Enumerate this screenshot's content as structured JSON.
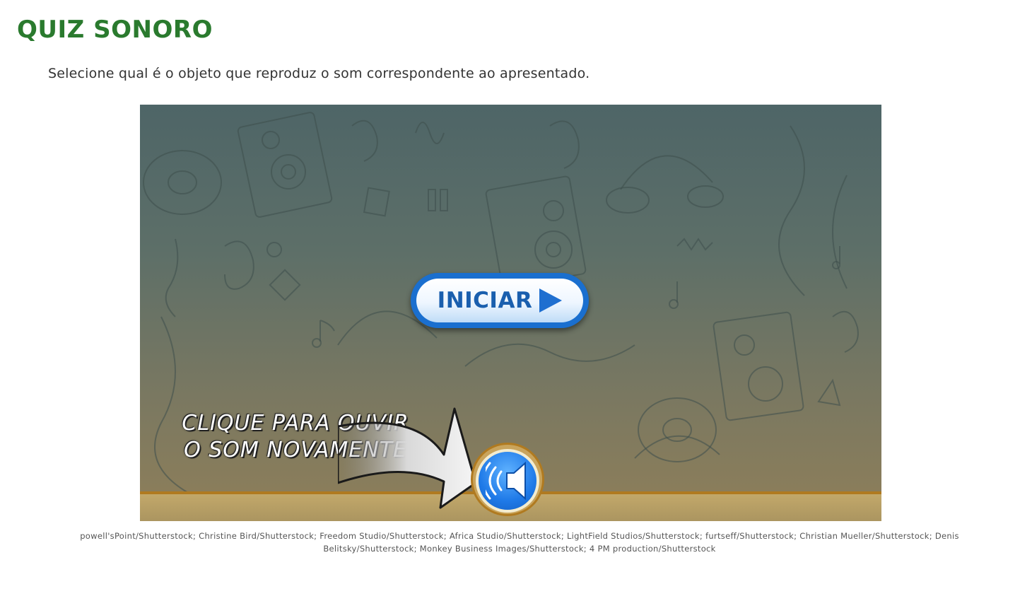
{
  "page": {
    "title": "QUIZ SONORO",
    "instruction": "Selecione qual é o objeto que reproduz o som correspondente ao apresentado."
  },
  "game": {
    "start_button_label": "INICIAR",
    "replay_hint_line1": "CLIQUE PARA OUVIR",
    "replay_hint_line2": "O SOM NOVAMENTE"
  },
  "credits": "powell'sPoint/Shutterstock; Christine Bird/Shutterstock; Freedom Studio/Shutterstock; Africa Studio/Shutterstock; LightField Studios/Shutterstock; furtseff/Shutterstock; Christian Mueller/Shutterstock; Denis Belitsky/Shutterstock; Monkey Business Images/Shutterstock; 4 PM production/Shutterstock",
  "icons": {
    "start": "play-icon",
    "replay": "speaker-icon"
  },
  "colors": {
    "title": "#2a7a2e",
    "button_blue": "#1a6fcf",
    "ground": "#b07a20"
  }
}
